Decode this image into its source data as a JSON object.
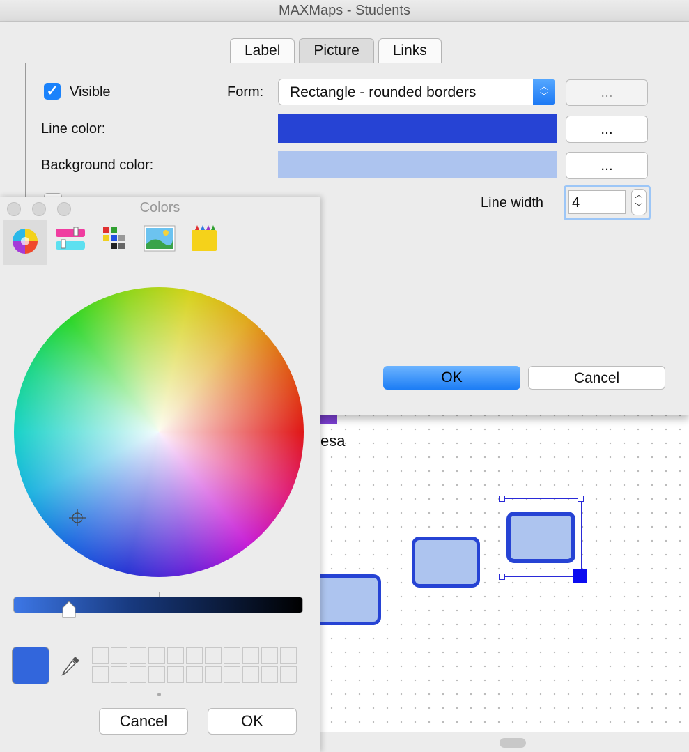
{
  "window": {
    "title": "MAXMaps - Students"
  },
  "tabs": [
    {
      "label": "Label"
    },
    {
      "label": "Picture"
    },
    {
      "label": "Links"
    }
  ],
  "form": {
    "visible_label": "Visible",
    "form_label": "Form:",
    "form_value": "Rectangle - rounded borders",
    "line_color_label": "Line color:",
    "background_color_label": "Background color:",
    "line_width_label": "Line width",
    "line_width_value": "4",
    "ellipsis_label": "...",
    "line_color": "#2643d4",
    "background_color": "#adc4ef"
  },
  "dialog_buttons": {
    "ok": "OK",
    "cancel": "Cancel"
  },
  "canvas": {
    "text_fragment": "esa"
  },
  "colors_panel": {
    "title": "Colors",
    "selected_color": "#3266dc",
    "cancel": "Cancel",
    "ok": "OK",
    "mode_icons": [
      "color-wheel-icon",
      "color-sliders-icon",
      "color-palettes-icon",
      "image-palettes-icon",
      "pencils-icon"
    ]
  }
}
